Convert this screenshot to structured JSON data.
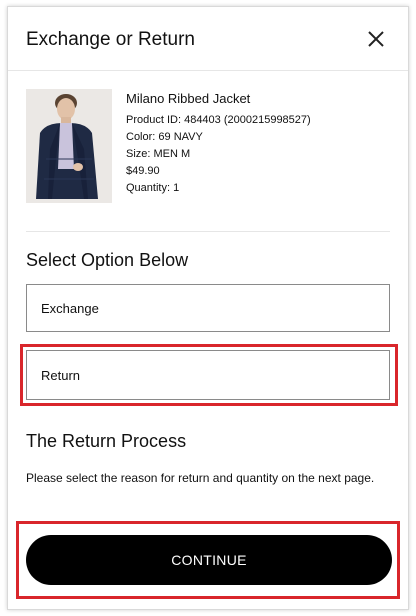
{
  "header": {
    "title": "Exchange or Return",
    "close_icon": "close-icon"
  },
  "product": {
    "name": "Milano Ribbed Jacket",
    "product_id": "Product ID: 484403 (2000215998527)",
    "color": "Color: 69 NAVY",
    "size": "Size: MEN M",
    "price": "$49.90",
    "quantity": "Quantity: 1",
    "image_icon": "product-photo"
  },
  "options": {
    "title": "Select Option Below",
    "exchange_label": "Exchange",
    "return_label": "Return"
  },
  "process": {
    "title": "The Return Process",
    "text": "Please select the reason for return and quantity on the next page."
  },
  "continue_label": "CONTINUE",
  "colors": {
    "highlight": "#d9262b",
    "button": "#000000",
    "jacket": "#1f2a44"
  }
}
